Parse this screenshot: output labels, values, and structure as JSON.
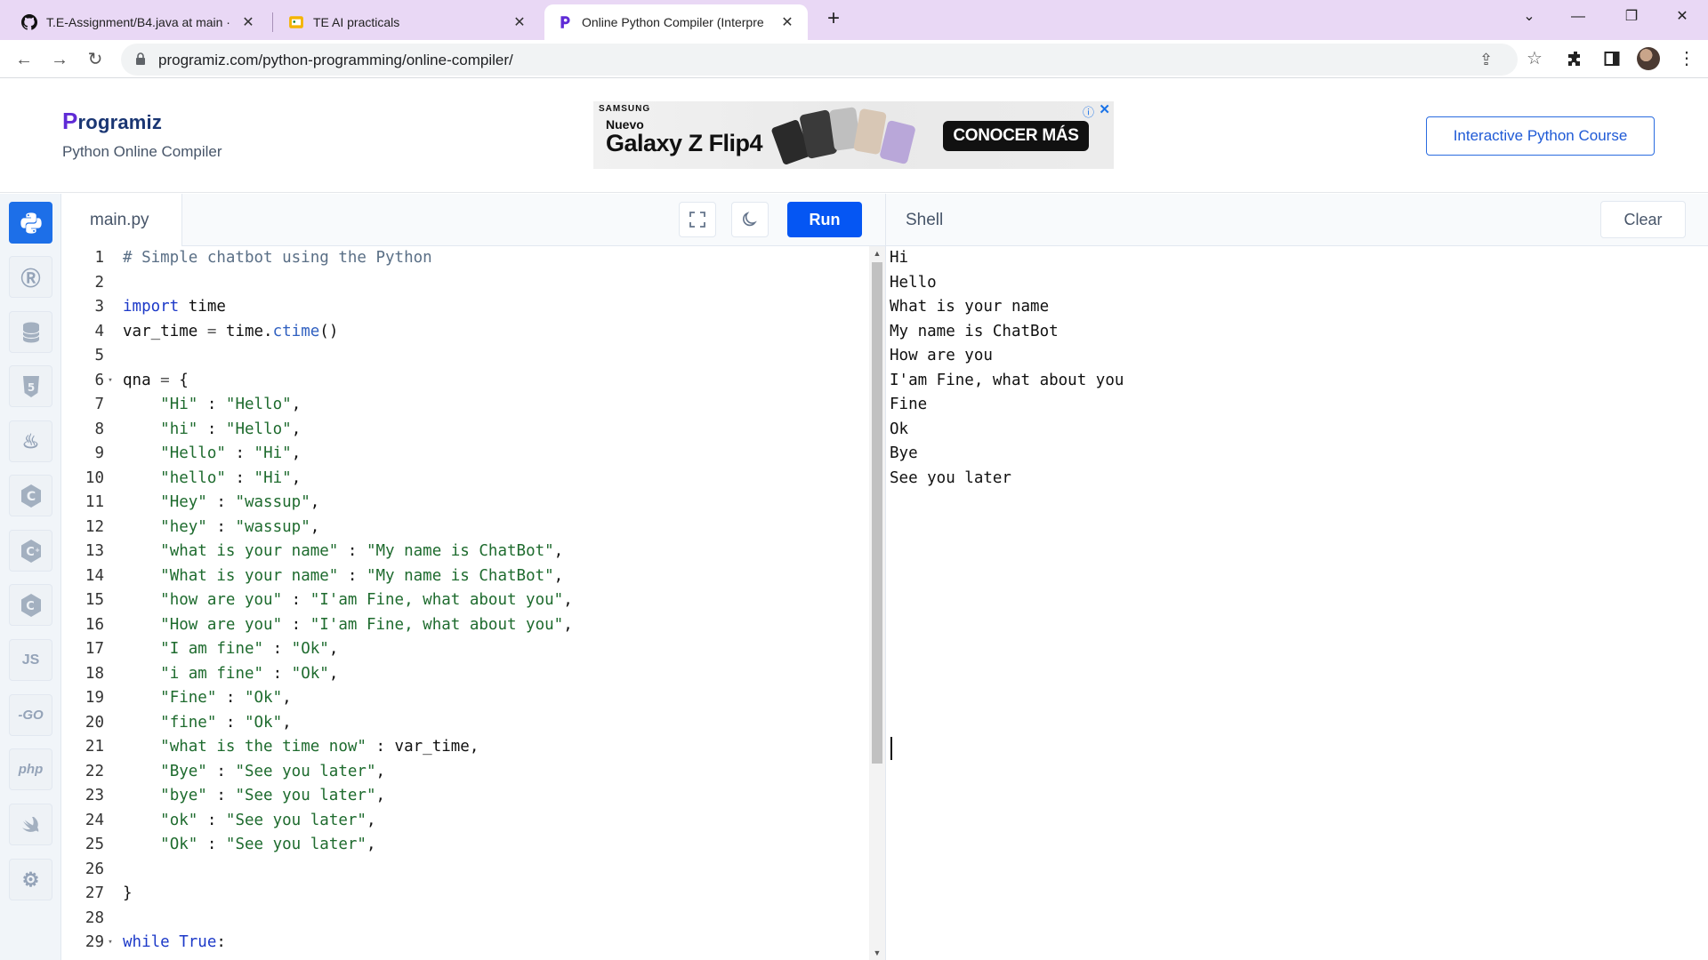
{
  "browser": {
    "tabs": [
      {
        "label": "T.E-Assignment/B4.java at main ·",
        "icon": "github-icon"
      },
      {
        "label": "TE AI practicals",
        "icon": "slides-icon"
      },
      {
        "label": "Online Python Compiler (Interpre",
        "icon": "programiz-icon"
      }
    ],
    "url": "programiz.com/python-programming/online-compiler/"
  },
  "header": {
    "logo_text": "rogramiz",
    "logo_p": "P",
    "subtitle": "Python Online Compiler",
    "course_button": "Interactive Python Course"
  },
  "ad": {
    "brand": "SAMSUNG",
    "nuevo": "Nuevo",
    "model": "Galaxy Z Flip4",
    "cta": "CONOCER MÁS"
  },
  "rail": [
    {
      "name": "python",
      "label": "",
      "active": true
    },
    {
      "name": "r",
      "label": "R"
    },
    {
      "name": "sql",
      "label": ""
    },
    {
      "name": "html",
      "label": "5"
    },
    {
      "name": "java",
      "label": ""
    },
    {
      "name": "c",
      "label": "C"
    },
    {
      "name": "cpp",
      "label": "C"
    },
    {
      "name": "csharp",
      "label": "C"
    },
    {
      "name": "js",
      "label": "JS"
    },
    {
      "name": "go",
      "label": "-GO"
    },
    {
      "name": "php",
      "label": "php"
    },
    {
      "name": "swift",
      "label": ""
    },
    {
      "name": "rust",
      "label": "R"
    }
  ],
  "editor": {
    "filename": "main.py",
    "run_label": "Run",
    "lines": [
      {
        "n": "1",
        "fold": "",
        "tokens": [
          [
            "cmt",
            "# Simple chatbot using the Python"
          ]
        ]
      },
      {
        "n": "2",
        "fold": "",
        "tokens": []
      },
      {
        "n": "3",
        "fold": "",
        "tokens": [
          [
            "kw",
            "import"
          ],
          [
            "",
            " time"
          ]
        ]
      },
      {
        "n": "4",
        "fold": "",
        "tokens": [
          [
            "",
            "var_time "
          ],
          [
            "op",
            "="
          ],
          [
            "",
            " time."
          ],
          [
            "fn",
            "ctime"
          ],
          [
            "",
            "()"
          ]
        ]
      },
      {
        "n": "5",
        "fold": "",
        "tokens": []
      },
      {
        "n": "6",
        "fold": "▾",
        "tokens": [
          [
            "",
            "qna "
          ],
          [
            "op",
            "="
          ],
          [
            "",
            " {"
          ]
        ]
      },
      {
        "n": "7",
        "fold": "",
        "tokens": [
          [
            "",
            "    "
          ],
          [
            "str",
            "\"Hi\""
          ],
          [
            "",
            " : "
          ],
          [
            "str",
            "\"Hello\""
          ],
          [
            "",
            ","
          ]
        ]
      },
      {
        "n": "8",
        "fold": "",
        "tokens": [
          [
            "",
            "    "
          ],
          [
            "str",
            "\"hi\""
          ],
          [
            "",
            " : "
          ],
          [
            "str",
            "\"Hello\""
          ],
          [
            "",
            ","
          ]
        ]
      },
      {
        "n": "9",
        "fold": "",
        "tokens": [
          [
            "",
            "    "
          ],
          [
            "str",
            "\"Hello\""
          ],
          [
            "",
            " : "
          ],
          [
            "str",
            "\"Hi\""
          ],
          [
            "",
            ","
          ]
        ]
      },
      {
        "n": "10",
        "fold": "",
        "tokens": [
          [
            "",
            "    "
          ],
          [
            "str",
            "\"hello\""
          ],
          [
            "",
            " : "
          ],
          [
            "str",
            "\"Hi\""
          ],
          [
            "",
            ","
          ]
        ]
      },
      {
        "n": "11",
        "fold": "",
        "tokens": [
          [
            "",
            "    "
          ],
          [
            "str",
            "\"Hey\""
          ],
          [
            "",
            " : "
          ],
          [
            "str",
            "\"wassup\""
          ],
          [
            "",
            ","
          ]
        ]
      },
      {
        "n": "12",
        "fold": "",
        "tokens": [
          [
            "",
            "    "
          ],
          [
            "str",
            "\"hey\""
          ],
          [
            "",
            " : "
          ],
          [
            "str",
            "\"wassup\""
          ],
          [
            "",
            ","
          ]
        ]
      },
      {
        "n": "13",
        "fold": "",
        "tokens": [
          [
            "",
            "    "
          ],
          [
            "str",
            "\"what is your name\""
          ],
          [
            "",
            " : "
          ],
          [
            "str",
            "\"My name is ChatBot\""
          ],
          [
            "",
            ","
          ]
        ]
      },
      {
        "n": "14",
        "fold": "",
        "tokens": [
          [
            "",
            "    "
          ],
          [
            "str",
            "\"What is your name\""
          ],
          [
            "",
            " : "
          ],
          [
            "str",
            "\"My name is ChatBot\""
          ],
          [
            "",
            ","
          ]
        ]
      },
      {
        "n": "15",
        "fold": "",
        "tokens": [
          [
            "",
            "    "
          ],
          [
            "str",
            "\"how are you\""
          ],
          [
            "",
            " : "
          ],
          [
            "str",
            "\"I'am Fine, what about you\""
          ],
          [
            "",
            ","
          ]
        ]
      },
      {
        "n": "16",
        "fold": "",
        "tokens": [
          [
            "",
            "    "
          ],
          [
            "str",
            "\"How are you\""
          ],
          [
            "",
            " : "
          ],
          [
            "str",
            "\"I'am Fine, what about you\""
          ],
          [
            "",
            ","
          ]
        ]
      },
      {
        "n": "17",
        "fold": "",
        "tokens": [
          [
            "",
            "    "
          ],
          [
            "str",
            "\"I am fine\""
          ],
          [
            "",
            " : "
          ],
          [
            "str",
            "\"Ok\""
          ],
          [
            "",
            ","
          ]
        ]
      },
      {
        "n": "18",
        "fold": "",
        "tokens": [
          [
            "",
            "    "
          ],
          [
            "str",
            "\"i am fine\""
          ],
          [
            "",
            " : "
          ],
          [
            "str",
            "\"Ok\""
          ],
          [
            "",
            ","
          ]
        ]
      },
      {
        "n": "19",
        "fold": "",
        "tokens": [
          [
            "",
            "    "
          ],
          [
            "str",
            "\"Fine\""
          ],
          [
            "",
            " : "
          ],
          [
            "str",
            "\"Ok\""
          ],
          [
            "",
            ","
          ]
        ]
      },
      {
        "n": "20",
        "fold": "",
        "tokens": [
          [
            "",
            "    "
          ],
          [
            "str",
            "\"fine\""
          ],
          [
            "",
            " : "
          ],
          [
            "str",
            "\"Ok\""
          ],
          [
            "",
            ","
          ]
        ]
      },
      {
        "n": "21",
        "fold": "",
        "tokens": [
          [
            "",
            "    "
          ],
          [
            "str",
            "\"what is the time now\""
          ],
          [
            "",
            " : var_time,"
          ]
        ]
      },
      {
        "n": "22",
        "fold": "",
        "tokens": [
          [
            "",
            "    "
          ],
          [
            "str",
            "\"Bye\""
          ],
          [
            "",
            " : "
          ],
          [
            "str",
            "\"See you later\""
          ],
          [
            "",
            ","
          ]
        ]
      },
      {
        "n": "23",
        "fold": "",
        "tokens": [
          [
            "",
            "    "
          ],
          [
            "str",
            "\"bye\""
          ],
          [
            "",
            " : "
          ],
          [
            "str",
            "\"See you later\""
          ],
          [
            "",
            ","
          ]
        ]
      },
      {
        "n": "24",
        "fold": "",
        "tokens": [
          [
            "",
            "    "
          ],
          [
            "str",
            "\"ok\""
          ],
          [
            "",
            " : "
          ],
          [
            "str",
            "\"See you later\""
          ],
          [
            "",
            ","
          ]
        ]
      },
      {
        "n": "25",
        "fold": "",
        "tokens": [
          [
            "",
            "    "
          ],
          [
            "str",
            "\"Ok\""
          ],
          [
            "",
            " : "
          ],
          [
            "str",
            "\"See you later\""
          ],
          [
            "",
            ","
          ]
        ]
      },
      {
        "n": "26",
        "fold": "",
        "tokens": []
      },
      {
        "n": "27",
        "fold": "",
        "tokens": [
          [
            "",
            "}"
          ]
        ]
      },
      {
        "n": "28",
        "fold": "",
        "tokens": []
      },
      {
        "n": "29",
        "fold": "▾",
        "tokens": [
          [
            "kw",
            "while"
          ],
          [
            "",
            " "
          ],
          [
            "kw",
            "True"
          ],
          [
            "",
            ":"
          ]
        ]
      }
    ]
  },
  "shell": {
    "title": "Shell",
    "clear_label": "Clear",
    "output": [
      "Hi",
      "Hello",
      "What is your name",
      "My name is ChatBot",
      "How are you",
      "I'am Fine, what about you",
      "Fine",
      "Ok",
      "Bye",
      "See you later"
    ]
  },
  "colors": {
    "accent": "#0556f3",
    "tabbar": "#e9d8f5",
    "string": "#1e6b2e",
    "keyword": "#1c39c8",
    "comment": "#5a6f86"
  }
}
